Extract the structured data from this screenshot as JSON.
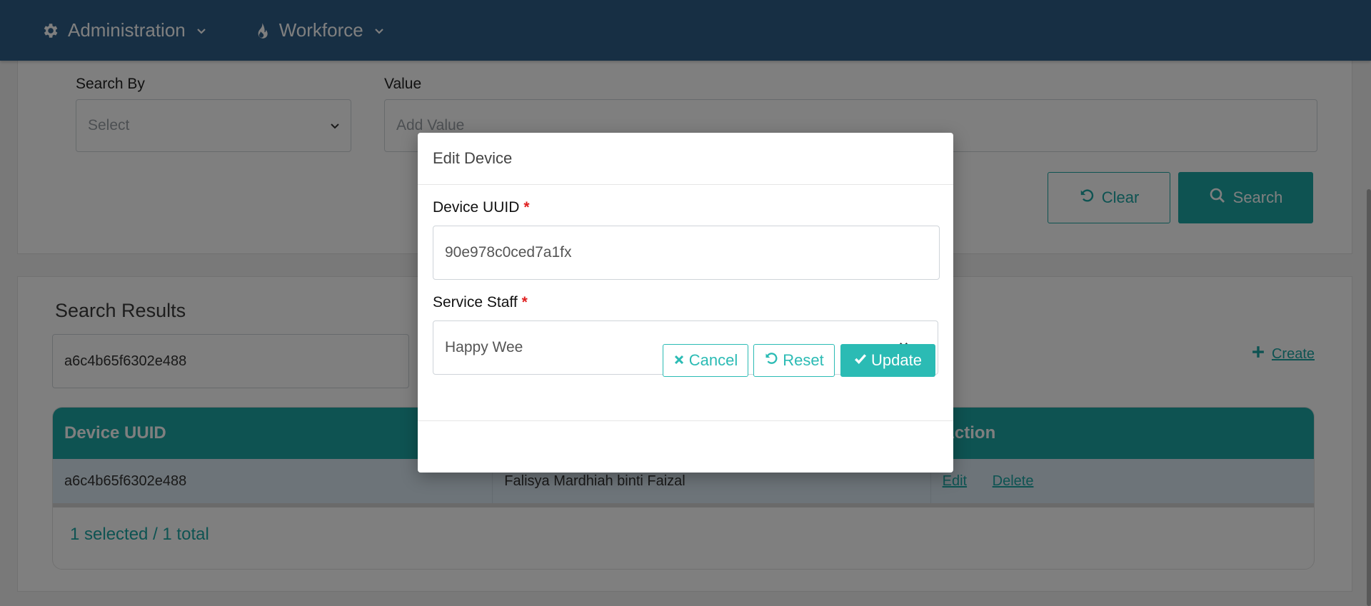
{
  "nav": {
    "items": [
      {
        "label": "Administration",
        "icon": "gear-icon"
      },
      {
        "label": "Workforce",
        "icon": "fire-icon"
      }
    ]
  },
  "search": {
    "search_by_label": "Search By",
    "search_by_value": "Select",
    "value_label": "Value",
    "value_placeholder": "Add Value",
    "clear_label": "Clear",
    "search_label": "Search"
  },
  "results": {
    "title": "Search Results",
    "filter_value": "a6c4b65f6302e488",
    "create_label": "Create",
    "columns": [
      "Device UUID",
      "",
      "Action"
    ],
    "rows": [
      {
        "uuid": "a6c4b65f6302e488",
        "staff": "Falisya Mardhiah binti Faizal",
        "edit": "Edit",
        "delete": "Delete"
      }
    ],
    "footer": "1 selected / 1 total"
  },
  "modal": {
    "title": "Edit Device",
    "uuid_label": "Device UUID",
    "required_mark": "*",
    "uuid_value": "90e978c0ced7a1fx",
    "staff_label": "Service Staff",
    "staff_value": "Happy Wee",
    "cancel_label": "Cancel",
    "reset_label": "Reset",
    "update_label": "Update"
  },
  "colors": {
    "nav_bg": "#2f5f88",
    "accent": "#1ca7a5",
    "required": "#e02020"
  }
}
